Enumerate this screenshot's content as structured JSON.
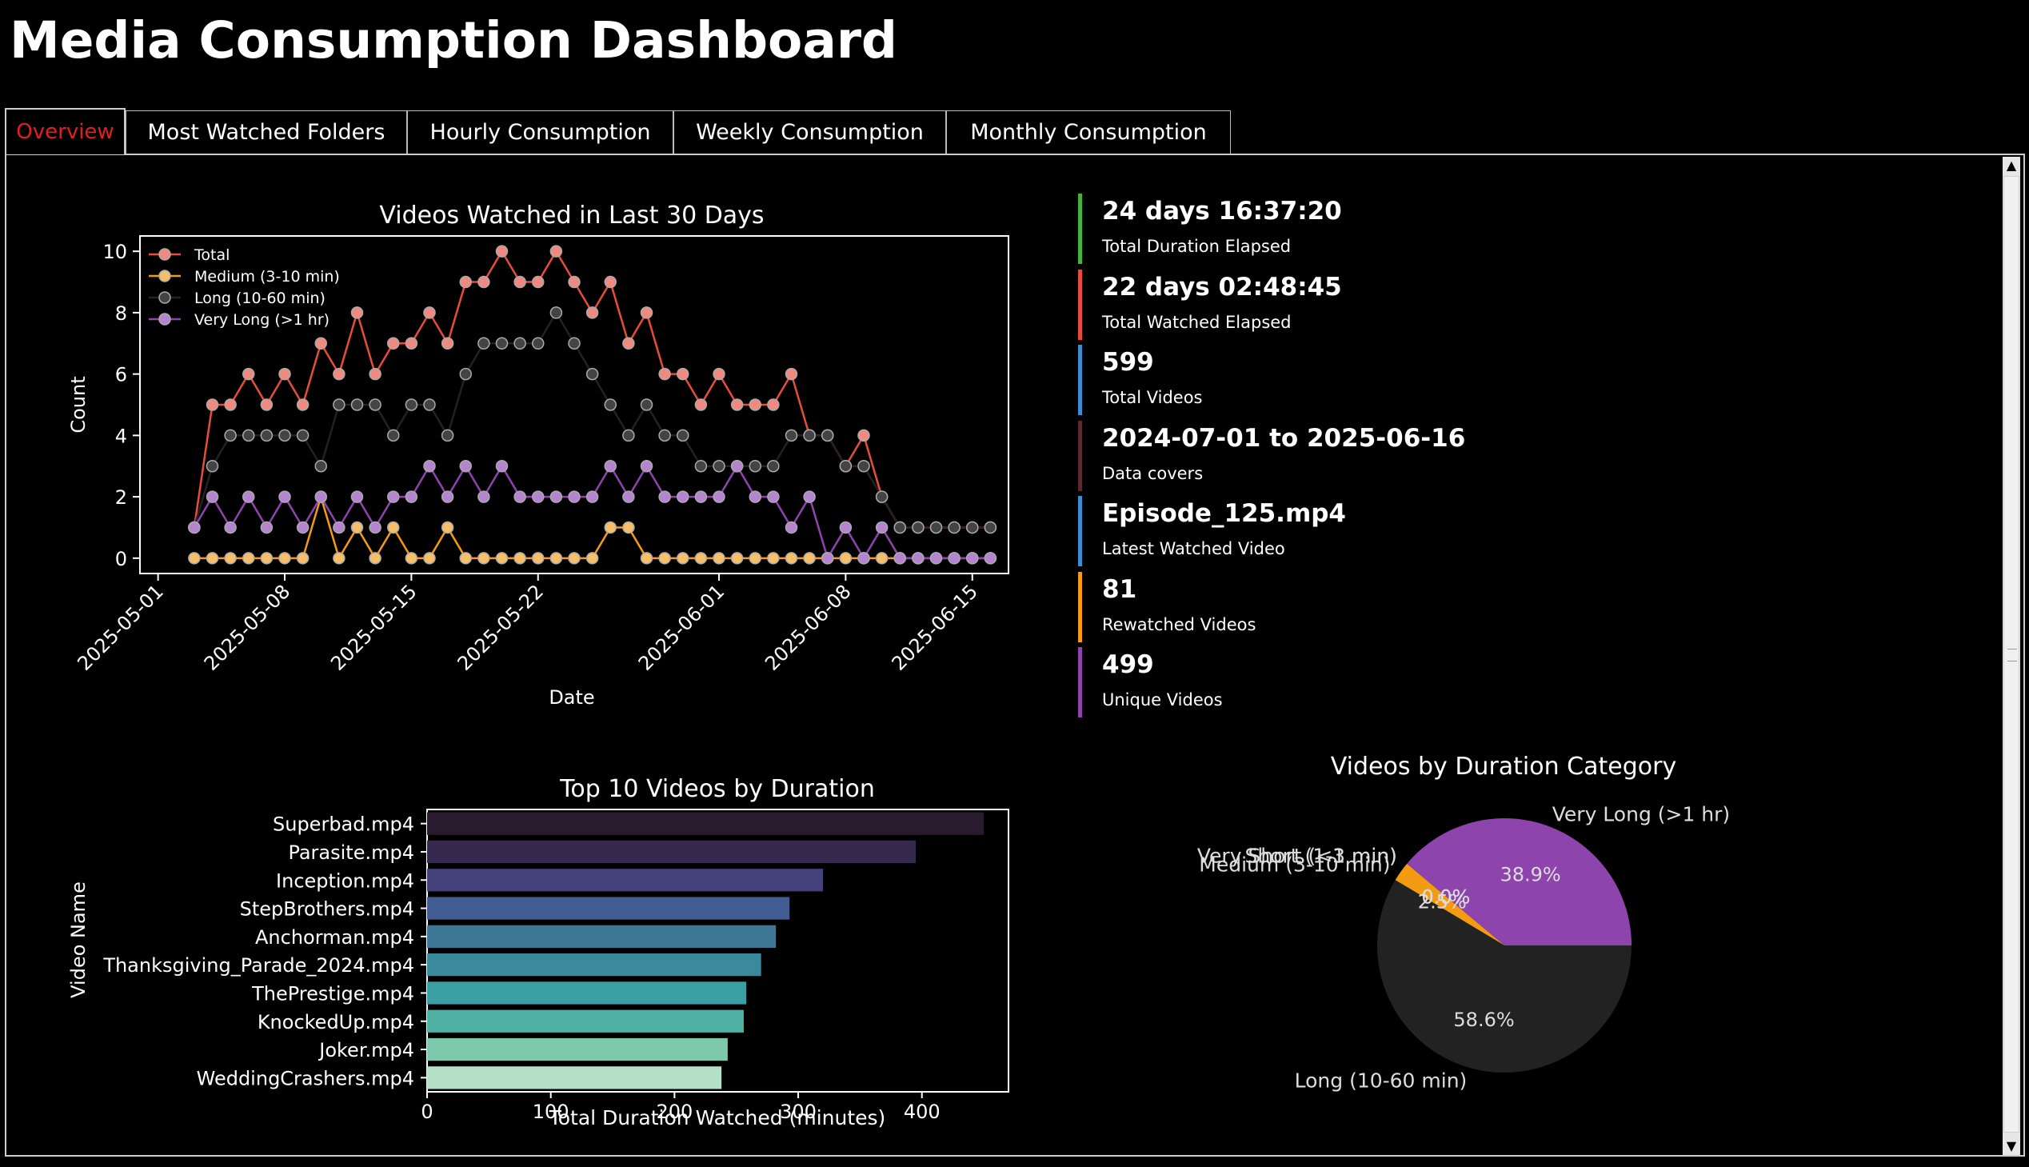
{
  "app_title": "Media Consumption Dashboard",
  "tabs": [
    {
      "label": "Overview",
      "active": true
    },
    {
      "label": "Most Watched Folders",
      "active": false
    },
    {
      "label": "Hourly Consumption",
      "active": false
    },
    {
      "label": "Weekly Consumption",
      "active": false
    },
    {
      "label": "Monthly Consumption",
      "active": false
    }
  ],
  "stats": [
    {
      "value": "24 days 16:37:20",
      "label": "Total Duration Elapsed",
      "color": "#44b33a"
    },
    {
      "value": "22 days 02:48:45",
      "label": "Total Watched Elapsed",
      "color": "#e84a3c"
    },
    {
      "value": "599",
      "label": "Total Videos",
      "color": "#3b8fd1"
    },
    {
      "value": "2024-07-01 to 2025-06-16",
      "label": "Data covers",
      "color": "#5a2a2a"
    },
    {
      "value": "Episode_125.mp4",
      "label": "Latest Watched Video",
      "color": "#3b8fd1"
    },
    {
      "value": "81",
      "label": "Rewatched Videos",
      "color": "#f39c12"
    },
    {
      "value": "499",
      "label": "Unique Videos",
      "color": "#8e44ad"
    }
  ],
  "chart_data": [
    {
      "type": "line",
      "title": "Videos Watched in Last 30 Days",
      "xlabel": "Date",
      "ylabel": "Count",
      "ylim": [
        -0.5,
        10.5
      ],
      "xlim": [
        "2025-04-30",
        "2025-06-17"
      ],
      "x_ticks": [
        "2025-05-01",
        "2025-05-08",
        "2025-05-15",
        "2025-05-22",
        "2025-06-01",
        "2025-06-08",
        "2025-06-15"
      ],
      "y_ticks": [
        0,
        2,
        4,
        6,
        8,
        10
      ],
      "legend_position": "top-left",
      "x_start": "2025-05-03",
      "x_end": "2025-06-16",
      "series": [
        {
          "name": "Total",
          "color": "#e74c3c",
          "marker_fill": "#f08a80",
          "values": [
            1,
            5,
            5,
            6,
            5,
            6,
            5,
            7,
            6,
            8,
            6,
            7,
            7,
            8,
            7,
            9,
            9,
            10,
            9,
            9,
            10,
            9,
            8,
            9,
            7,
            8,
            6,
            6,
            5,
            6,
            5,
            5,
            5,
            6,
            4,
            4,
            3,
            4,
            2,
            1,
            1,
            1,
            1,
            1,
            1
          ]
        },
        {
          "name": "Medium (3-10 min)",
          "color": "#f39c12",
          "marker_fill": "#f7bf6a",
          "values": [
            0,
            0,
            0,
            0,
            0,
            0,
            0,
            2,
            0,
            1,
            0,
            1,
            0,
            0,
            1,
            0,
            0,
            0,
            0,
            0,
            0,
            0,
            0,
            1,
            1,
            0,
            0,
            0,
            0,
            0,
            0,
            0,
            0,
            0,
            0,
            0,
            0,
            0,
            0,
            0,
            0,
            0,
            0,
            0,
            0
          ]
        },
        {
          "name": "Long (10-60 min)",
          "color": "#222222",
          "marker_fill": "#444444",
          "values": [
            1,
            3,
            4,
            4,
            4,
            4,
            4,
            3,
            5,
            5,
            5,
            4,
            5,
            5,
            4,
            6,
            7,
            7,
            7,
            7,
            8,
            7,
            6,
            5,
            4,
            5,
            4,
            4,
            3,
            3,
            3,
            3,
            3,
            4,
            4,
            4,
            3,
            3,
            2,
            1,
            1,
            1,
            1,
            1,
            1
          ]
        },
        {
          "name": "Very Long (>1 hr)",
          "color": "#8e44ad",
          "marker_fill": "#b584d0",
          "values": [
            1,
            2,
            1,
            2,
            1,
            2,
            1,
            2,
            1,
            2,
            1,
            2,
            2,
            3,
            2,
            3,
            2,
            3,
            2,
            2,
            2,
            2,
            2,
            3,
            2,
            3,
            2,
            2,
            2,
            2,
            3,
            2,
            2,
            1,
            2,
            0,
            1,
            0,
            1,
            0,
            0,
            0,
            0,
            0,
            0
          ]
        }
      ]
    },
    {
      "type": "bar",
      "orientation": "horizontal",
      "title": "Top 10 Videos by Duration",
      "xlabel": "Total Duration Watched (minutes)",
      "ylabel": "Video Name",
      "xlim": [
        0,
        470
      ],
      "x_ticks": [
        0,
        100,
        200,
        300,
        400
      ],
      "categories": [
        "Superbad.mp4",
        "Parasite.mp4",
        "Inception.mp4",
        "StepBrothers.mp4",
        "Anchorman.mp4",
        "Thanksgiving_Parade_2024.mp4",
        "ThePrestige.mp4",
        "KnockedUp.mp4",
        "Joker.mp4",
        "WeddingCrashers.mp4"
      ],
      "values": [
        450,
        395,
        320,
        293,
        282,
        270,
        258,
        256,
        243,
        238
      ],
      "colors": [
        "#2a1a2e",
        "#352a4d",
        "#43407a",
        "#425d93",
        "#3f7797",
        "#3a8a9c",
        "#3b9ea3",
        "#4fb0a4",
        "#7dc9ad",
        "#b3e0c6"
      ]
    },
    {
      "type": "pie",
      "title": "Videos by Duration Category",
      "slices": [
        {
          "label": "Very Long (>1 hr)",
          "value": 38.9,
          "pct_label": "38.9%",
          "color": "#8e44ad"
        },
        {
          "label": "Very Short (<1 min)",
          "value": 0.0,
          "pct_label": "0.0%",
          "color": "#1f77b4"
        },
        {
          "label": "Short (1-3 min)",
          "value": 0.0,
          "pct_label": "0.0%",
          "color": "#2ca02c"
        },
        {
          "label": "Medium (3-10 min)",
          "value": 2.5,
          "pct_label": "2.5%",
          "color": "#f39c12"
        },
        {
          "label": "Long (10-60 min)",
          "value": 58.6,
          "pct_label": "58.6%",
          "color": "#222222"
        }
      ]
    }
  ]
}
